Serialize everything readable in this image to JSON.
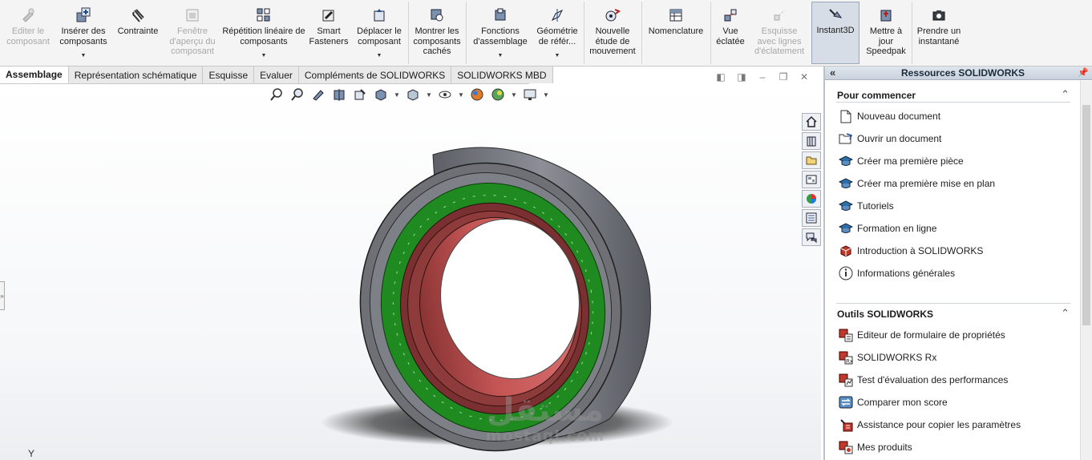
{
  "ribbon": {
    "edit_component": "Editer le composant",
    "insert_components": "Insérer des composants",
    "mate": "Contrainte",
    "preview_window": "Fenêtre d'aperçu du composant",
    "linear_pattern": "Répétition linéaire de composants",
    "smart_fasteners": "Smart Fasteners",
    "move_component": "Déplacer le composant",
    "show_hidden": "Montrer les composants cachés",
    "assembly_features": "Fonctions d'assemblage",
    "reference_geometry": "Géométrie de référ...",
    "new_motion_study": "Nouvelle étude de mouvement",
    "bom": "Nomenclature",
    "exploded_view": "Vue éclatée",
    "explode_line_sketch": "Esquisse avec lignes d'éclatement",
    "instant3d": "Instant3D",
    "update_speedpak": "Mettre à jour Speedpak",
    "take_snapshot": "Prendre un instantané"
  },
  "tabs": [
    "Assemblage",
    "Représentation schématique",
    "Esquisse",
    "Evaluer",
    "Compléments de SOLIDWORKS",
    "SOLIDWORKS MBD"
  ],
  "viewport": {
    "axis_label": "Y",
    "watermark_ar": "مستقل",
    "watermark_latin": "mostaql.com"
  },
  "panel": {
    "title": "Ressources SOLIDWORKS",
    "section1": "Pour commencer",
    "getting_started": [
      {
        "label": "Nouveau document",
        "icon": "new-document-icon"
      },
      {
        "label": "Ouvrir un document",
        "icon": "open-document-icon"
      },
      {
        "label": "Créer ma première pièce",
        "icon": "graduation-cap-icon"
      },
      {
        "label": "Créer ma première mise en plan",
        "icon": "graduation-cap-icon"
      },
      {
        "label": "Tutoriels",
        "icon": "graduation-cap-icon"
      },
      {
        "label": "Formation en ligne",
        "icon": "graduation-cap-icon"
      },
      {
        "label": "Introduction à SOLIDWORKS",
        "icon": "solidworks-cube-icon"
      },
      {
        "label": "Informations générales",
        "icon": "info-icon"
      }
    ],
    "section2": "Outils SOLIDWORKS",
    "tools": [
      {
        "label": "Editeur de formulaire de propriétés",
        "icon": "sw-tool-icon"
      },
      {
        "label": "SOLIDWORKS Rx",
        "icon": "sw-rx-icon"
      },
      {
        "label": "Test d'évaluation des performances",
        "icon": "sw-tool-icon"
      },
      {
        "label": "Comparer mon score",
        "icon": "compare-icon"
      },
      {
        "label": "Assistance pour copier les paramètres",
        "icon": "copy-settings-icon"
      },
      {
        "label": "Mes produits",
        "icon": "sw-tool-icon"
      }
    ]
  },
  "colors": {
    "ring_green": "#1f8a1f",
    "ring_red": "#8e3b3b",
    "ring_gray": "#6e7075",
    "panel_header": "#c9d2dd"
  }
}
